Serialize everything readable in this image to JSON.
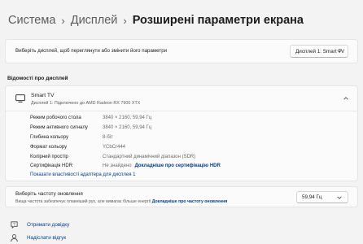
{
  "breadcrumb": {
    "item1": "Система",
    "item2": "Дисплей",
    "current": "Розширені параметри екрана",
    "separator": "›"
  },
  "display_select": {
    "label": "Виберіть дисплей, щоб переглянути або змінити його параметри",
    "value": "Дисплей 1: Smart TV"
  },
  "display_info": {
    "section_title": "Відомості про дисплей",
    "device_name": "Smart TV",
    "device_subtitle": "Дисплей 1: Підключено до AMD Radeon RX 7900 XTX",
    "rows": [
      {
        "label": "Режим робочого стола",
        "value": "3840 × 2160, 59,94 Гц"
      },
      {
        "label": "Режим активного сигналу",
        "value": "3840 × 2160, 59,94 Гц"
      },
      {
        "label": "Глибина кольору",
        "value": "8-біт"
      },
      {
        "label": "Формат кольору",
        "value": "YCbCr444"
      },
      {
        "label": "Колірний простір",
        "value": "Стандартний динамічний діапазон (SDR)"
      },
      {
        "label": "Сертифікація HDR",
        "value": "Не знайдено",
        "link": "Докладніше про сертифікацію HDR"
      }
    ],
    "adapter_link": "Показати властивості адаптера для дисплея 1"
  },
  "refresh_rate": {
    "title": "Виберіть частоту оновлення",
    "subtitle": "Вища частота забезпечує плавніший рух, але вимагає більше енергії",
    "link": "Докладніше про частоту оновлення",
    "value": "59,94 Гц"
  },
  "footer": {
    "help": "Отримати довідку",
    "feedback": "Надіслати відгук"
  },
  "colors": {
    "link": "#003e92",
    "background": "#f3f3f3",
    "card": "#fbfbfb"
  },
  "icons": [
    "monitor-icon",
    "chevron-down-icon",
    "chevron-up-icon",
    "help-icon",
    "feedback-icon"
  ]
}
